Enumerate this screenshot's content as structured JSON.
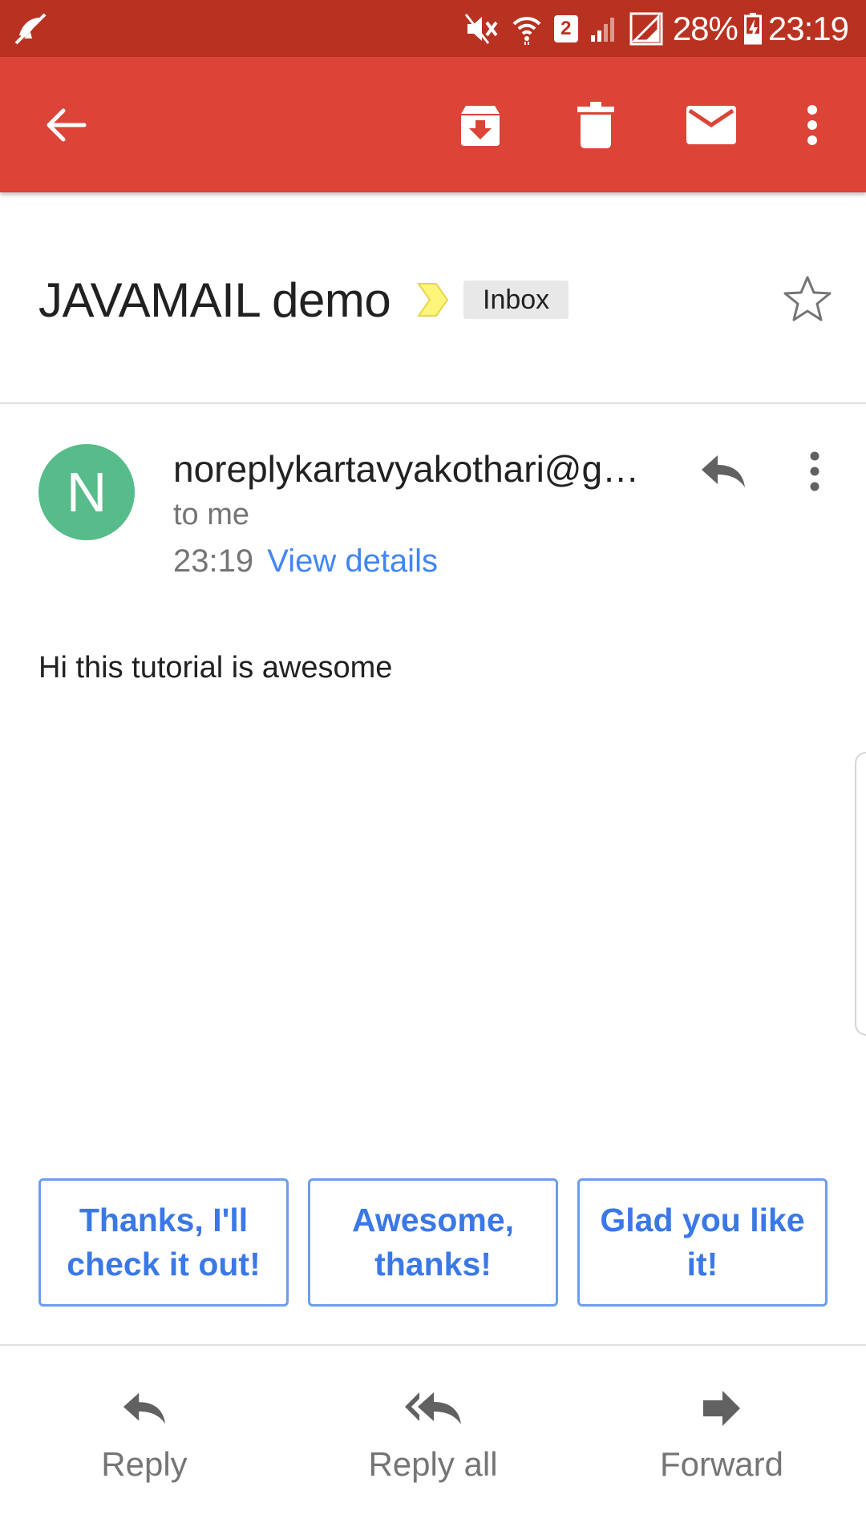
{
  "status_bar": {
    "sim_slot": "2",
    "battery_percent": "28%",
    "time": "23:19",
    "icons": [
      "notification-off-icon",
      "mute-icon",
      "wifi-icon",
      "sim-badge",
      "signal-icon",
      "signal-icon",
      "battery-charging-icon"
    ]
  },
  "toolbar": {
    "color": "#db4437",
    "icons": [
      "back-arrow-icon",
      "archive-icon",
      "delete-icon",
      "mark-unread-icon",
      "more-vert-icon"
    ]
  },
  "message": {
    "subject": "JAVAMAIL demo",
    "label": "Inbox",
    "sender": "noreplykartavyakothari@gmail.com",
    "avatar_letter": "N",
    "avatar_color": "#57bb8a",
    "recipient": "to me",
    "time": "23:19",
    "view_details": "View details",
    "body": "Hi this tutorial is awesome"
  },
  "smart_replies": [
    "Thanks, I'll check it out!",
    "Awesome, thanks!",
    "Glad you like it!"
  ],
  "actions": {
    "reply": "Reply",
    "reply_all": "Reply all",
    "forward": "Forward"
  }
}
